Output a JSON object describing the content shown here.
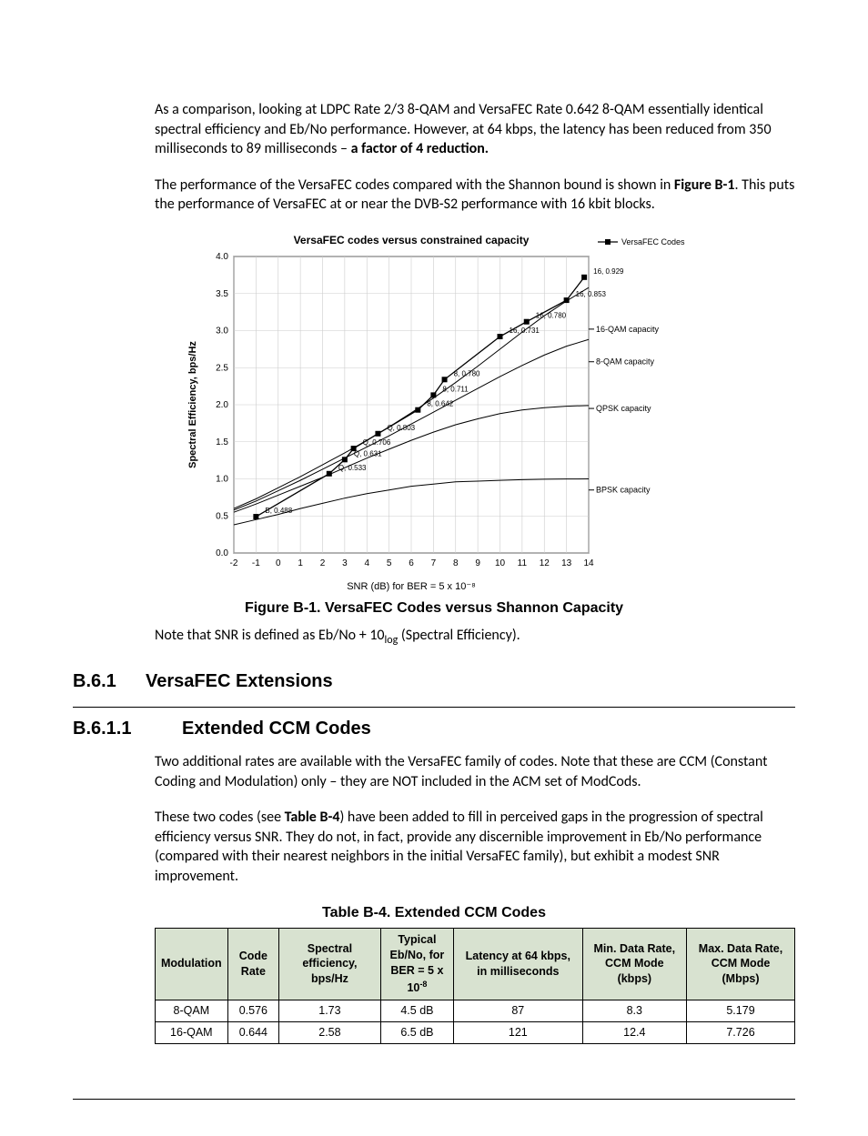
{
  "para1_a": "As a comparison, looking at LDPC Rate 2/3 8-QAM and VersaFEC Rate 0.642 8-QAM essentially identical spectral efficiency and Eb/No performance. However, at 64 kbps, the latency has been reduced from 350 milliseconds to 89 milliseconds – ",
  "para1_b": "a factor of 4 reduction.",
  "para2_a": "The performance of the VersaFEC codes compared with the Shannon bound is shown in ",
  "para2_b": "Figure B-1",
  "para2_c": ". This puts the performance of VersaFEC at or near the DVB-S2 performance with 16 kbit blocks.",
  "fig_caption": "Figure B-1. VersaFEC Codes versus Shannon Capacity",
  "note_a": "Note that SNR is defined as Eb/No + 10",
  "note_sub": "log",
  "note_b": " (Spectral Efficiency).",
  "sec_b61_num": "B.6.1",
  "sec_b61_title": "VersaFEC Extensions",
  "sec_b611_num": "B.6.1.1",
  "sec_b611_title": "Extended CCM Codes",
  "para3": "Two additional rates are available with the VersaFEC family of codes. Note that these are CCM (Constant Coding and Modulation) only – they are NOT included in the ACM set of ModCods.",
  "para4_a": "These two codes (see ",
  "para4_b": "Table B-4",
  "para4_c": ") have been added to fill in perceived gaps in the progression of spectral efficiency versus SNR. They do not, in fact,  provide any discernible improvement in Eb/No performance (compared with their nearest neighbors in the initial VersaFEC family), but exhibit a modest SNR improvement.",
  "table_caption": "Table B-4. Extended CCM Codes",
  "th": {
    "c1": "Modulation",
    "c2": "Code Rate",
    "c3": "Spectral efficiency, bps/Hz",
    "c4a": "Typical Eb/No, for",
    "c4b": "BER = 5 x 10",
    "c4sup": "-8",
    "c5": "Latency at 64 kbps, in milliseconds",
    "c6": "Min. Data Rate, CCM Mode (kbps)",
    "c7": "Max. Data Rate, CCM Mode (Mbps)"
  },
  "row1": {
    "c1": "8-QAM",
    "c2": "0.576",
    "c3": "1.73",
    "c4": "4.5 dB",
    "c5": "87",
    "c6": "8.3",
    "c7": "5.179"
  },
  "row2": {
    "c1": "16-QAM",
    "c2": "0.644",
    "c3": "2.58",
    "c4": "6.5 dB",
    "c5": "121",
    "c6": "12.4",
    "c7": "7.726"
  },
  "chart_data": {
    "type": "line",
    "title": "VersaFEC codes versus constrained capacity",
    "xlabel": "SNR (dB) for BER = 5 x 10^-8",
    "ylabel": "Spectral Efficiency, bps/Hz",
    "xlim": [
      -2,
      14
    ],
    "ylim": [
      0,
      4
    ],
    "xticks": [
      -2,
      -1,
      0,
      1,
      2,
      3,
      4,
      5,
      6,
      7,
      8,
      9,
      10,
      11,
      12,
      13,
      14
    ],
    "yticks": [
      0.0,
      0.5,
      1.0,
      1.5,
      2.0,
      2.5,
      3.0,
      3.5,
      4.0
    ],
    "legend": [
      "VersaFEC Codes"
    ],
    "capacity_labels": [
      "BPSK capacity",
      "QPSK capacity",
      "8-QAM capacity",
      "16-QAM capacity"
    ],
    "series": [
      {
        "name": "BPSK capacity",
        "x": [
          -2,
          -1,
          0,
          1,
          2,
          3,
          4,
          5,
          6,
          7,
          8,
          9,
          10,
          11,
          12,
          13,
          14
        ],
        "y": [
          0.38,
          0.45,
          0.52,
          0.6,
          0.67,
          0.74,
          0.8,
          0.85,
          0.9,
          0.93,
          0.96,
          0.97,
          0.98,
          0.99,
          0.995,
          0.998,
          1.0
        ]
      },
      {
        "name": "QPSK capacity",
        "x": [
          -2,
          -1,
          0,
          1,
          2,
          3,
          4,
          5,
          6,
          7,
          8,
          9,
          10,
          11,
          12,
          13,
          14
        ],
        "y": [
          0.55,
          0.66,
          0.78,
          0.9,
          1.02,
          1.15,
          1.28,
          1.4,
          1.52,
          1.63,
          1.73,
          1.81,
          1.88,
          1.93,
          1.96,
          1.98,
          1.99
        ]
      },
      {
        "name": "8-QAM capacity",
        "x": [
          -2,
          -1,
          0,
          1,
          2,
          3,
          4,
          5,
          6,
          7,
          8,
          9,
          10,
          11,
          12,
          13,
          14
        ],
        "y": [
          0.58,
          0.7,
          0.84,
          0.98,
          1.13,
          1.28,
          1.43,
          1.58,
          1.74,
          1.9,
          2.06,
          2.22,
          2.38,
          2.53,
          2.67,
          2.79,
          2.88
        ]
      },
      {
        "name": "16-QAM capacity",
        "x": [
          -2,
          -1,
          0,
          1,
          2,
          3,
          4,
          5,
          6,
          7,
          8,
          9,
          10,
          11,
          12,
          13,
          14
        ],
        "y": [
          0.6,
          0.73,
          0.88,
          1.03,
          1.19,
          1.35,
          1.52,
          1.7,
          1.89,
          2.09,
          2.3,
          2.52,
          2.75,
          2.98,
          3.2,
          3.4,
          3.58
        ]
      },
      {
        "name": "VersaFEC",
        "marker": "square",
        "x": [
          -1.0,
          2.3,
          3.0,
          3.4,
          4.5,
          6.3,
          7.0,
          7.5,
          10.0,
          11.2,
          13.0,
          13.8
        ],
        "y": [
          0.49,
          1.07,
          1.26,
          1.41,
          1.61,
          1.93,
          2.13,
          2.34,
          2.92,
          3.12,
          3.41,
          3.72
        ],
        "labels": [
          "B, 0.488",
          "Q, 0.533",
          "Q, 0.631",
          "Q, 0.706",
          "Q, 0.803",
          "8, 0.642",
          "8, 0.711",
          "8, 0.780",
          "16, 0.731",
          "16, 0.780",
          "16, 0.853",
          "16, 0.929"
        ]
      }
    ]
  }
}
